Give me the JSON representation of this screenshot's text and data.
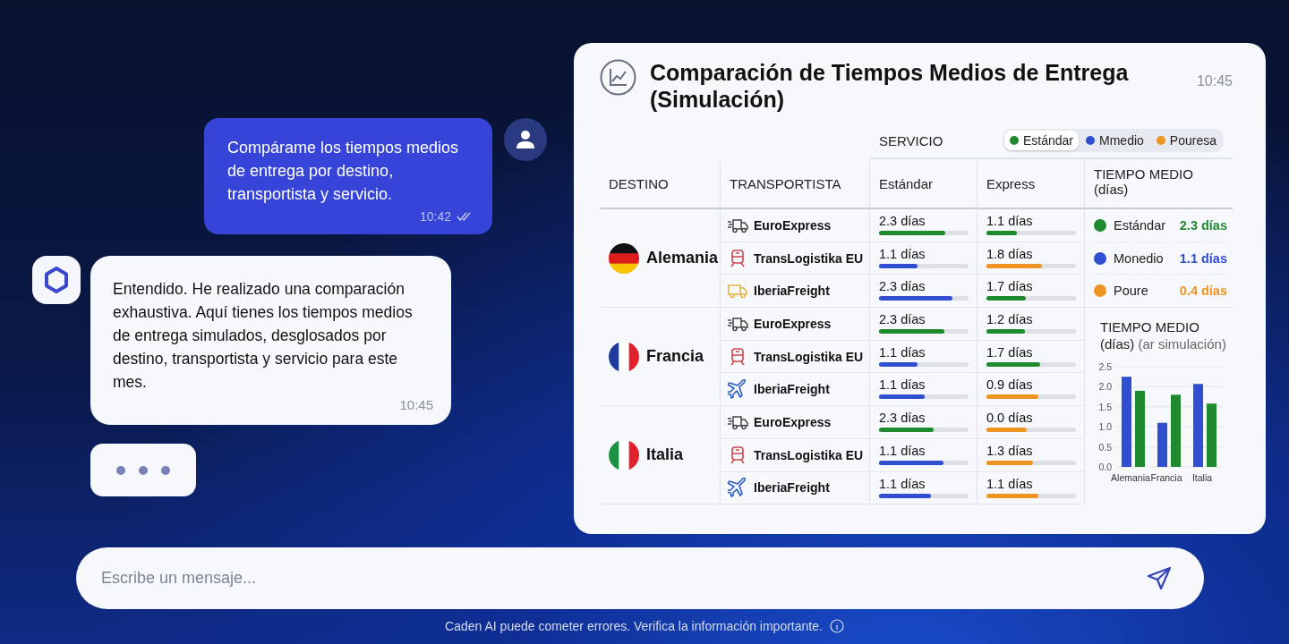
{
  "messages": [
    {
      "kind": "user",
      "text": "Compárame los tiempos medios de entrega por destino, transportista y servicio.",
      "time": "10:42",
      "read": true
    },
    {
      "kind": "bot",
      "text": "Entendido. He realizado una comparación exhaustiva. Aquí tienes los tiempos medios de entrega simulados, desglosados por destino, transportista y servicio para este mes.",
      "time": "10:45"
    }
  ],
  "typing": true,
  "panel": {
    "title": "Comparación de Tiempos Medios de Entrega (Simulación)",
    "time": "10:45",
    "service_label": "SERVICIO",
    "legend": [
      {
        "label": "Estándar",
        "color": "#1f8a2e",
        "selected": true
      },
      {
        "label": "Mmedio",
        "color": "#2f4fd0",
        "selected": false
      },
      {
        "label": "Pouresa",
        "color": "#ee9420",
        "selected": false
      }
    ],
    "columns": [
      "DESTINO",
      "TRANSPORTISTA",
      "Estándar",
      "Express",
      "TIEMPO MEDIO (días)"
    ],
    "destinations": [
      {
        "name": "Alemania",
        "kind": "de",
        "carriers": [
          {
            "name": "EuroExpress",
            "kind": "truck",
            "standard": {
              "text": "2.3 días",
              "level": 0.74,
              "color": "#1f8a2e"
            },
            "express": {
              "text": "1.1 días",
              "level": 0.34,
              "color": "#1f8a2e"
            }
          },
          {
            "name": "TransLogistika EU",
            "kind": "train",
            "standard": {
              "text": "1.1 días",
              "level": 0.43,
              "color": "#2f4fd0"
            },
            "express": {
              "text": "1.8 días",
              "level": 0.62,
              "color": "#ee9420"
            }
          },
          {
            "name": "IberiaFreight",
            "kind": "van",
            "standard": {
              "text": "2.3 días",
              "level": 0.82,
              "color": "#2f4fd0"
            },
            "express": {
              "text": "1.7 días",
              "level": 0.44,
              "color": "#1f8a2e"
            }
          }
        ]
      },
      {
        "name": "Francia",
        "kind": "fr",
        "carriers": [
          {
            "name": "EuroExpress",
            "kind": "truck",
            "standard": {
              "text": "2.3 días",
              "level": 0.73,
              "color": "#1f8a2e"
            },
            "express": {
              "text": "1.2 días",
              "level": 0.43,
              "color": "#1f8a2e"
            }
          },
          {
            "name": "TransLogistika EU",
            "kind": "train",
            "standard": {
              "text": "1.1 días",
              "level": 0.43,
              "color": "#2f4fd0"
            },
            "express": {
              "text": "1.7 días",
              "level": 0.6,
              "color": "#1f8a2e"
            }
          },
          {
            "name": "IberiaFreight",
            "kind": "plane",
            "standard": {
              "text": "1.1 días",
              "level": 0.51,
              "color": "#2f4fd0"
            },
            "express": {
              "text": "0.9 días",
              "level": 0.58,
              "color": "#ee9420"
            }
          }
        ]
      },
      {
        "name": "Italia",
        "kind": "it",
        "carriers": [
          {
            "name": "EuroExpress",
            "kind": "truck",
            "standard": {
              "text": "2.3 días",
              "level": 0.61,
              "color": "#1f8a2e"
            },
            "express": {
              "text": "0.0 días",
              "level": 0.45,
              "color": "#ee9420"
            }
          },
          {
            "name": "TransLogistika EU",
            "kind": "train",
            "standard": {
              "text": "1.1 días",
              "level": 0.72,
              "color": "#2f4fd0"
            },
            "express": {
              "text": "1.3 días",
              "level": 0.52,
              "color": "#ee9420"
            }
          },
          {
            "name": "IberiaFreight",
            "kind": "plane",
            "standard": {
              "text": "1.1 días",
              "level": 0.58,
              "color": "#2f4fd0"
            },
            "express": {
              "text": "1.1 días",
              "level": 0.58,
              "color": "#ee9420"
            }
          }
        ]
      }
    ],
    "summary": [
      {
        "label": "Estándar",
        "value": "2.3 días",
        "color": "#1f8a2e"
      },
      {
        "label": "Monedio",
        "value": "1.1 días",
        "color": "#2f4fd0"
      },
      {
        "label": "Poure",
        "value": "0.4 días",
        "color": "#ee9420"
      }
    ],
    "chart_title": "TIEMPO MEDIO",
    "chart_unit": "(días)",
    "chart_note": "(ar simulación)",
    "chart_data": {
      "type": "bar",
      "categories": [
        "Alemania",
        "Francia",
        "Italia"
      ],
      "series": [
        {
          "color": "#2f4fd0",
          "values": [
            2.25,
            1.1,
            2.07
          ]
        },
        {
          "color": "#1f8a2e",
          "values": [
            1.9,
            1.8,
            1.58
          ]
        }
      ],
      "grid": true,
      "ylim": [
        0,
        2.5
      ],
      "yticks": [
        {
          "value": 0,
          "label": "0.0"
        },
        {
          "value": 0.5,
          "label": "0.5"
        },
        {
          "value": 1,
          "label": "1.0"
        },
        {
          "value": 1.5,
          "label": "1.5"
        },
        {
          "value": 2,
          "label": "2.0"
        },
        {
          "value": 2.5,
          "label": "2.5"
        }
      ]
    }
  },
  "composer": {
    "placeholder": "Escribe un mensaje..."
  },
  "disclaimer": "Caden AI puede cometer errores. Verifica la información importante."
}
